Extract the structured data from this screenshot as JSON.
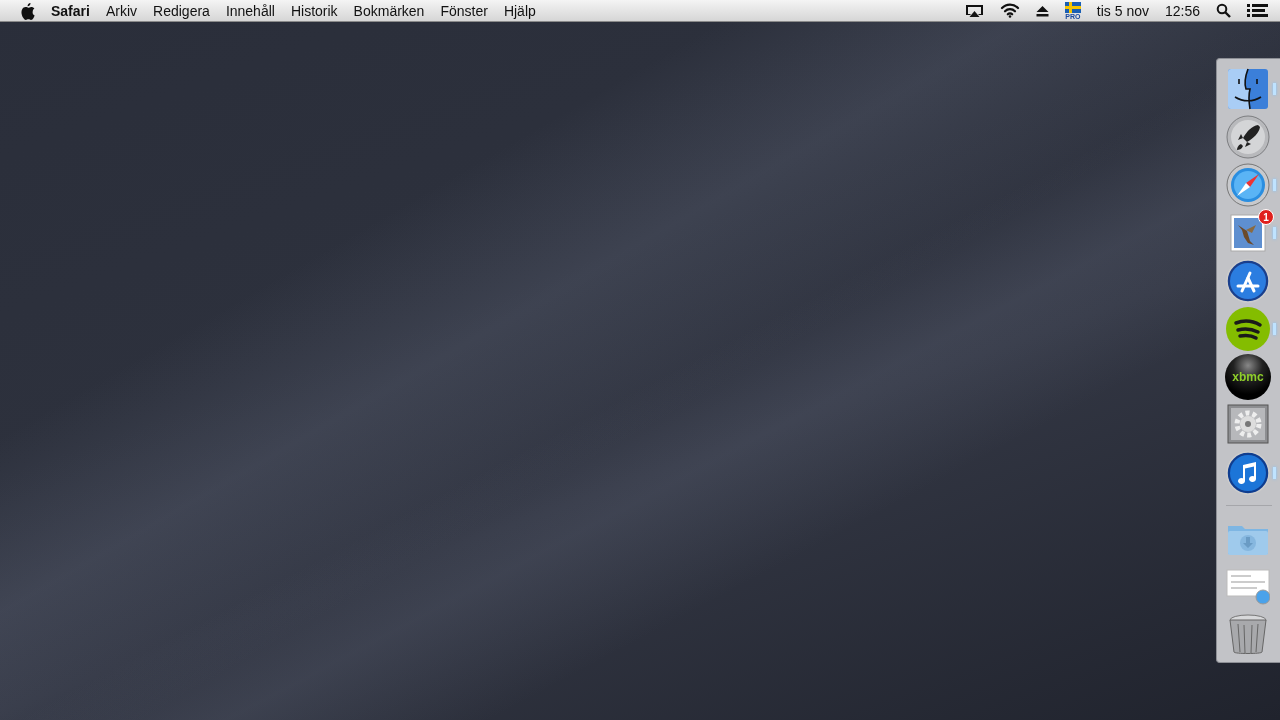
{
  "menu_bar": {
    "app_name": "Safari",
    "menus": [
      "Arkiv",
      "Redigera",
      "Innehåll",
      "Historik",
      "Bokmärken",
      "Fönster",
      "Hjälp"
    ],
    "status": {
      "input_label": "PRO",
      "date": "tis 5 nov",
      "time": "12:56"
    }
  },
  "dock": {
    "apps": [
      {
        "kind": "finder",
        "running": true
      },
      {
        "kind": "launchpad",
        "running": false
      },
      {
        "kind": "safari",
        "running": true
      },
      {
        "kind": "mail",
        "running": true,
        "badge": "1"
      },
      {
        "kind": "appstore",
        "running": false
      },
      {
        "kind": "spotify",
        "running": true
      },
      {
        "kind": "xbmc",
        "running": false,
        "logo_text": "xbmc"
      },
      {
        "kind": "settings",
        "running": false
      },
      {
        "kind": "itunes",
        "running": true
      }
    ],
    "stacks": [
      {
        "kind": "downloads"
      },
      {
        "kind": "document"
      },
      {
        "kind": "trash"
      }
    ]
  }
}
